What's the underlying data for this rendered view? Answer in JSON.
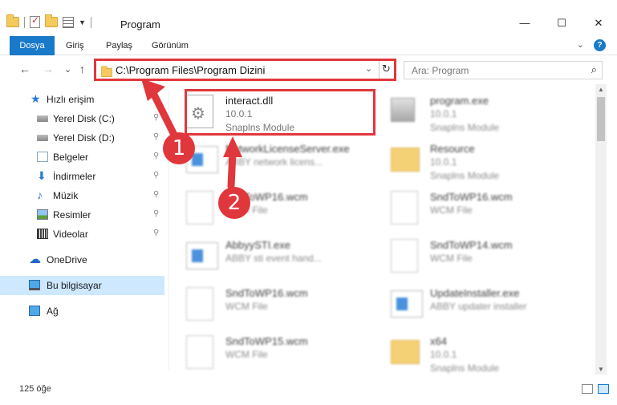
{
  "window": {
    "title": "Program",
    "minimize": "—",
    "maximize": "☐",
    "close": "✕"
  },
  "ribbon": {
    "tabs": [
      "Dosya",
      "Giriş",
      "Paylaş",
      "Görünüm"
    ],
    "expand": "⌄",
    "help": "?"
  },
  "nav": {
    "back": "←",
    "forward": "→",
    "recent": "⌄",
    "up": "↑",
    "address": "C:\\Program Files\\Program Dizini",
    "address_dropdown": "⌄",
    "refresh": "↻",
    "search_placeholder": "Ara: Program",
    "search_icon": "⌕"
  },
  "sidebar": {
    "items": [
      {
        "label": "Hızlı erişim",
        "icon": "star-icon",
        "pinned": false
      },
      {
        "label": "Yerel Disk (C:)",
        "icon": "drive-icon",
        "pinned": true
      },
      {
        "label": "Yerel Disk (D:)",
        "icon": "drive-icon",
        "pinned": true
      },
      {
        "label": "Belgeler",
        "icon": "documents-icon",
        "pinned": true
      },
      {
        "label": "İndirmeler",
        "icon": "download-icon",
        "pinned": true
      },
      {
        "label": "Müzik",
        "icon": "music-icon",
        "pinned": true
      },
      {
        "label": "Resimler",
        "icon": "pictures-icon",
        "pinned": true
      },
      {
        "label": "Videolar",
        "icon": "videos-icon",
        "pinned": true
      },
      {
        "label": "OneDrive",
        "icon": "cloud-icon",
        "pinned": false
      },
      {
        "label": "Bu bilgisayar",
        "icon": "computer-icon",
        "pinned": false,
        "selected": true
      },
      {
        "label": "Ağ",
        "icon": "network-icon",
        "pinned": false
      }
    ],
    "pin_glyph": "📌"
  },
  "files": [
    {
      "name": "interact.dll",
      "version": "10.0.1",
      "type": "Snaplns Module",
      "icon": "dll-icon",
      "highlighted": true
    },
    {
      "name": "program.exe",
      "version": "10.0.1",
      "type": "Snaplns Module",
      "icon": "program-icon"
    },
    {
      "name": "NetworkLicenseServer.exe",
      "version": "ABBY network licens...",
      "type": "",
      "icon": "exe-icon"
    },
    {
      "name": "Resource",
      "version": "10.0.1",
      "type": "Snaplns Module",
      "icon": "folder-icon"
    },
    {
      "name": "SndToWP16.wcm",
      "version": "WCM File",
      "type": "",
      "icon": "file-icon"
    },
    {
      "name": "SndToWP16.wcm",
      "version": "WCM File",
      "type": "",
      "icon": "file-icon"
    },
    {
      "name": "AbbyySTI.exe",
      "version": "ABBY sti event hand...",
      "type": "",
      "icon": "exe-icon"
    },
    {
      "name": "SndToWP14.wcm",
      "version": "WCM File",
      "type": "",
      "icon": "file-icon"
    },
    {
      "name": "SndToWP16.wcm",
      "version": "WCM File",
      "type": "",
      "icon": "file-icon"
    },
    {
      "name": "UpdateInstaller.exe",
      "version": "ABBY updater installer",
      "type": "",
      "icon": "exe-icon"
    },
    {
      "name": "SndToWP15.wcm",
      "version": "WCM File",
      "type": "",
      "icon": "file-icon"
    },
    {
      "name": "x64",
      "version": "10.0.1",
      "type": "Snaplns Module",
      "icon": "folder-icon"
    }
  ],
  "status": {
    "count": "125 öğe"
  },
  "annotations": {
    "step1": "1",
    "step2": "2",
    "arrow_color": "#e0373d"
  }
}
